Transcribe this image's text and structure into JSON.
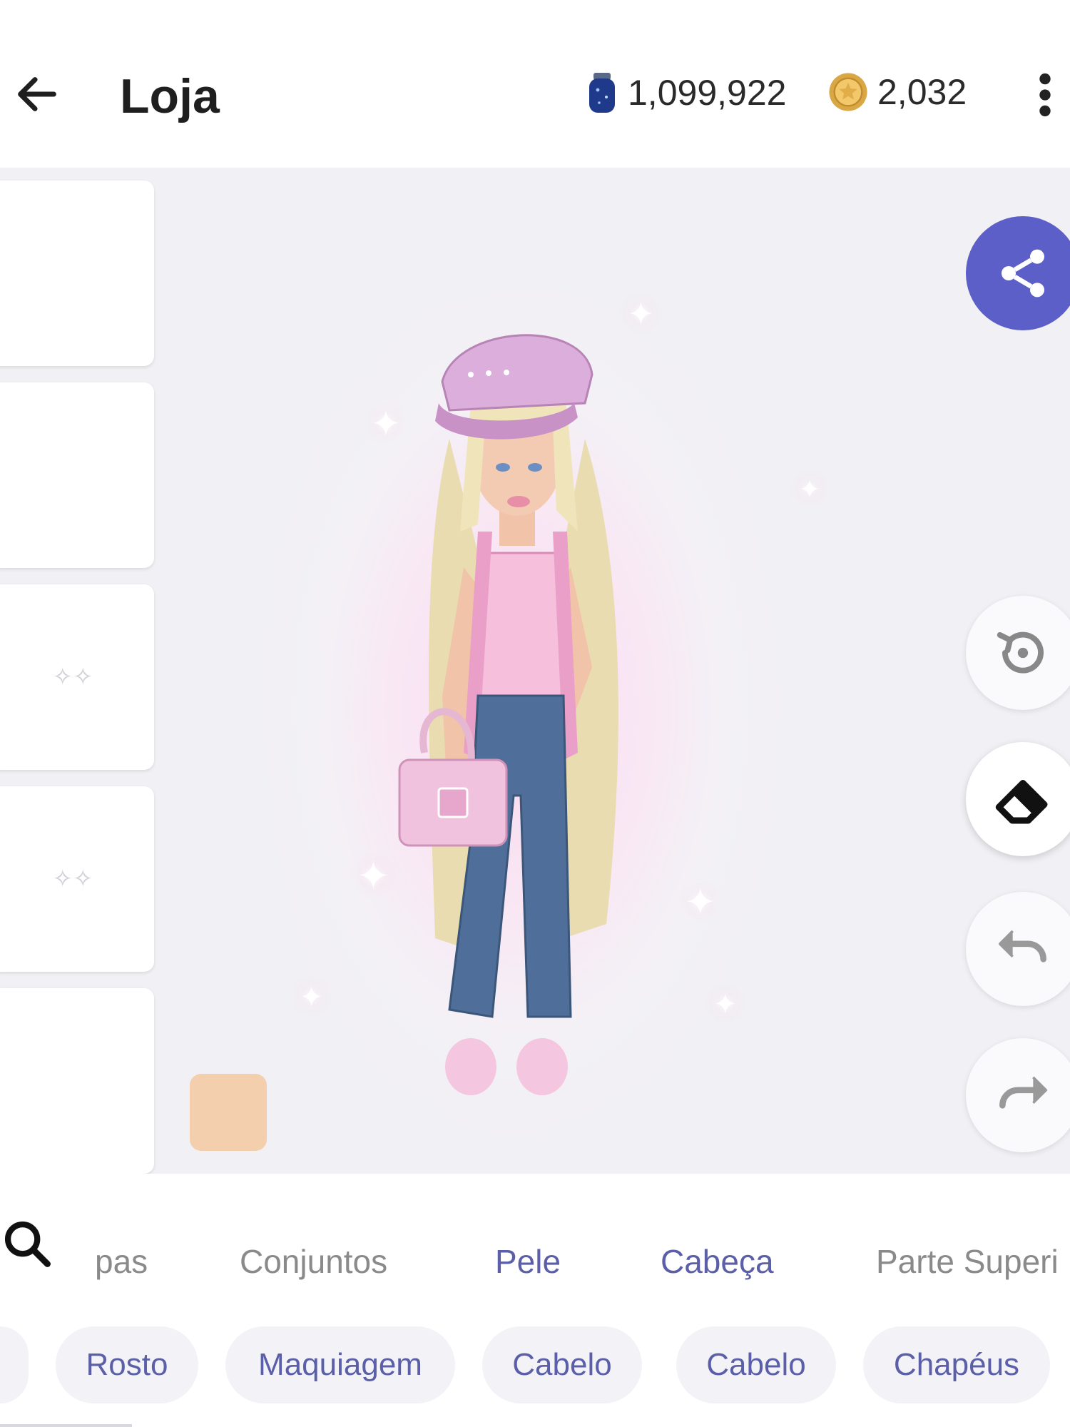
{
  "header": {
    "title": "Loja",
    "gems": "1,099,922",
    "coins": "2,032"
  },
  "icons": {
    "back": "arrow-left-icon",
    "gem": "gem-jar-icon",
    "coin": "coin-icon",
    "more": "more-vertical-icon",
    "share": "share-icon",
    "reset": "reset-icon",
    "eraser": "eraser-icon",
    "undo": "undo-icon",
    "redo": "redo-icon",
    "search": "search-icon"
  },
  "colors": {
    "accent": "#5b5fc7",
    "tab_active": "#5b5fa8",
    "skin_swatch": "#f4cfad"
  },
  "tabs": [
    {
      "label": "pas",
      "active": false
    },
    {
      "label": "Conjuntos",
      "active": false
    },
    {
      "label": "Pele",
      "active": true
    },
    {
      "label": "Cabeça",
      "active": true
    },
    {
      "label": "Parte Superi",
      "active": false
    }
  ],
  "chips": [
    "Rosto",
    "Maquiagem",
    "Cabelo",
    "Cabelo",
    "Chapéus"
  ]
}
